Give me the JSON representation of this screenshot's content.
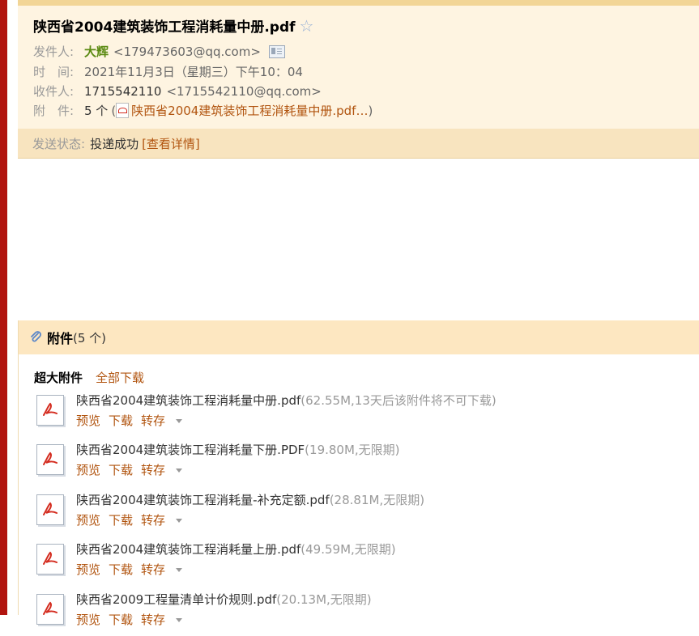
{
  "mail": {
    "subject": "陕西省2004建筑装饰工程消耗量中册.pdf",
    "star_glyph": "☆",
    "from_label": "发件人:",
    "from_name": "大辉",
    "from_email": "<179473603@qq.com>",
    "time_label": "时　间:",
    "time_value": "2021年11月3日（星期三）下午10：04",
    "to_label": "收件人:",
    "to_name": "1715542110",
    "to_email": "<1715542110@qq.com>",
    "attach_label": "附　件:",
    "attach_count": "5 个",
    "attach_open": "(",
    "attach_first": "陕西省2004建筑装饰工程消耗量中册.pdf…",
    "attach_close": ")",
    "status_label": "发送状态:",
    "status_value": "投递成功",
    "status_detail": "[查看详情]"
  },
  "attachments": {
    "title": "附件",
    "count": "(5 个)",
    "section_label": "超大附件",
    "download_all": "全部下载",
    "actions": {
      "preview": "预览",
      "download": "下载",
      "forward": "转存"
    },
    "files": [
      {
        "name": "陕西省2004建筑装饰工程消耗量中册.pdf",
        "meta": "(62.55M,13天后该附件将不可下载)"
      },
      {
        "name": "陕西省2004建筑装饰工程消耗量下册.PDF",
        "meta": "(19.80M,无限期)"
      },
      {
        "name": "陕西省2004建筑装饰工程消耗量-补充定额.pdf",
        "meta": "(28.81M,无限期)"
      },
      {
        "name": "陕西省2004建筑装饰工程消耗量上册.pdf",
        "meta": "(49.59M,无限期)"
      },
      {
        "name": "陕西省2009工程量清单计价规则.pdf",
        "meta": "(20.13M,无限期)"
      }
    ]
  },
  "colors": {
    "accent": "#b1540f",
    "header_bg": "#fef4e1",
    "sidebar_red": "#b1140f"
  }
}
